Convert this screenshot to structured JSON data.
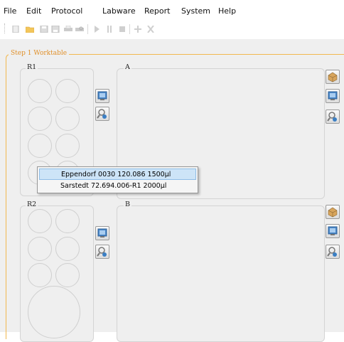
{
  "menu": [
    "File",
    "Edit",
    "Protocol",
    "Labware",
    "Report",
    "System",
    "Help"
  ],
  "toolbar_icons": [
    "new-icon",
    "open-icon",
    "save-icon",
    "save-as-icon",
    "print-icon",
    "print-preview-icon",
    "play-icon",
    "pause-icon",
    "stop-icon",
    "add-icon",
    "delete-icon"
  ],
  "step": {
    "legend": "Step 1 Worktable"
  },
  "panels": {
    "r1": "R1",
    "a": "A",
    "r2": "R2",
    "b": "B"
  },
  "dropdown": {
    "items": [
      "Eppendorf 0030 120.086  1500µl",
      "Sarstedt 72.694.006-R1 2000µl"
    ],
    "selected_index": 0
  },
  "colors": {
    "accent": "#f2b84f",
    "highlight": "#cde4f7",
    "work_bg": "#efefef"
  }
}
